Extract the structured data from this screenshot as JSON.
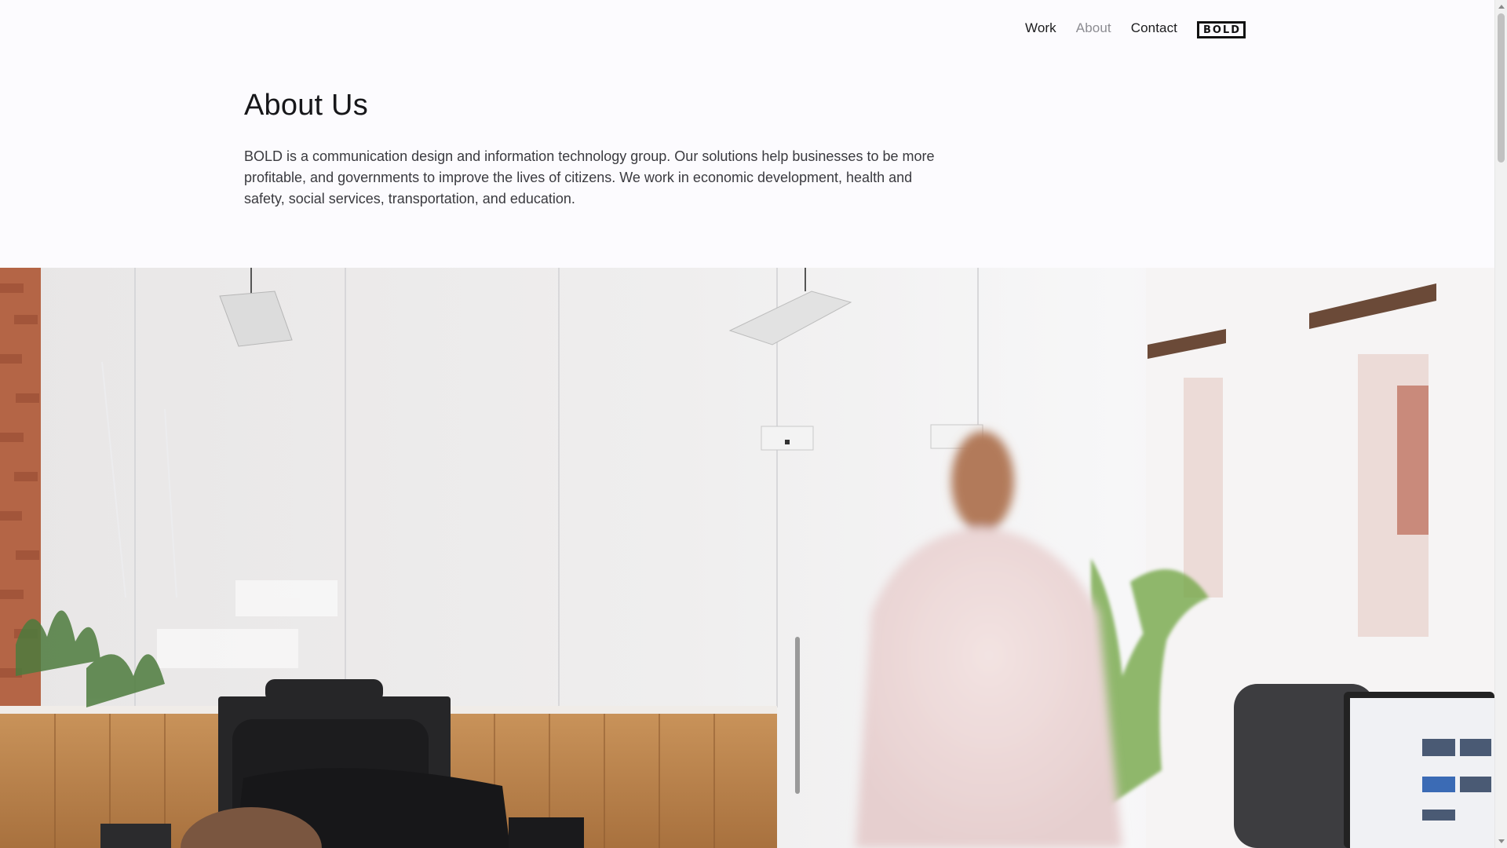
{
  "nav": {
    "items": [
      {
        "label": "Work"
      },
      {
        "label": "About"
      },
      {
        "label": "Contact"
      }
    ],
    "active": "About",
    "logo_text": "BOLD"
  },
  "main": {
    "title": "About Us",
    "intro": "BOLD is a communication design and information technology group. Our solutions help businesses to be more profitable, and governments to improve the lives of citizens. We work in economic development, health and safety, social services, transportation, and education."
  },
  "colors": {
    "background": "#fcfbfe",
    "text": "#1b1b1d",
    "active_nav": "#8c8c92"
  },
  "icons": {
    "scroll_up": "chevron-up-icon",
    "scroll_down": "chevron-down-icon"
  }
}
